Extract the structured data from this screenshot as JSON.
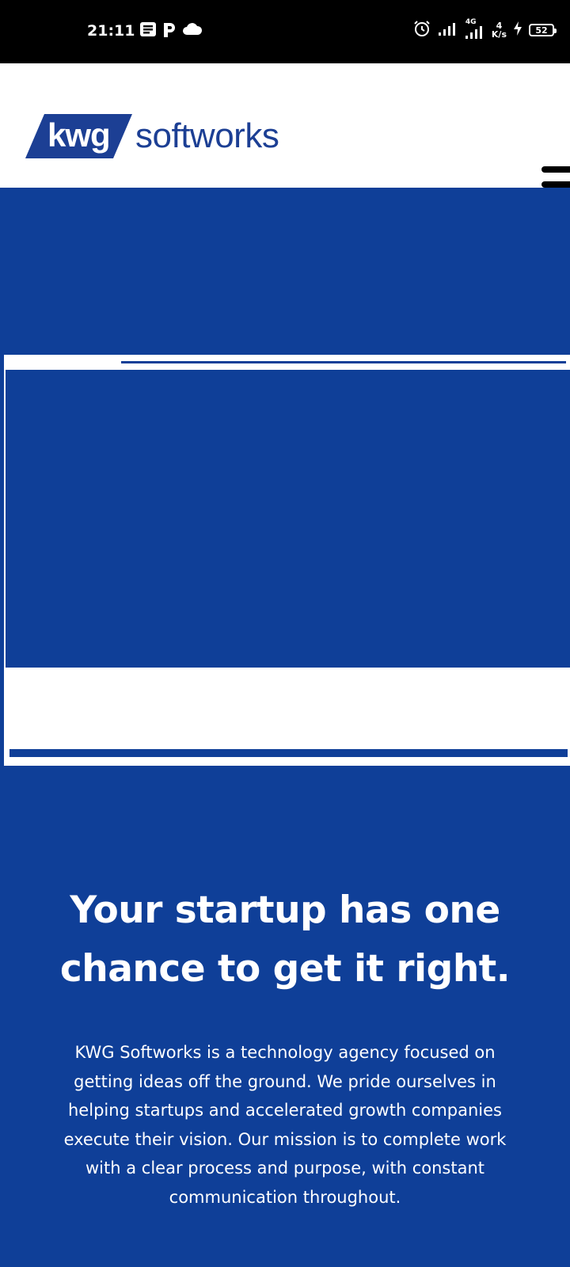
{
  "status_bar": {
    "time": "21:11",
    "network_type": "4G",
    "speed_value": "4",
    "speed_unit": "K/s",
    "battery": "52",
    "icons": [
      "notes-icon",
      "parking-icon",
      "cloud-icon",
      "alarm-icon",
      "signal-icon",
      "signal-4g-icon",
      "charging-icon",
      "battery-icon"
    ]
  },
  "header": {
    "logo_badge": "kwg",
    "logo_word": "softworks",
    "menu_icon": "hamburger-icon"
  },
  "hero": {
    "media_progress": 0.2,
    "title": "Your startup has one chance to get it right.",
    "body": "KWG Softworks is a technology agency focused on getting ideas off the ground. We pride ourselves in helping startups and accelerated growth companies execute their vision. Our mission is to complete work with a clear process and purpose, with constant communication throughout."
  },
  "colors": {
    "brand_blue": "#0f3f98",
    "logo_blue": "#1c3f94",
    "white": "#ffffff",
    "black": "#000000"
  }
}
